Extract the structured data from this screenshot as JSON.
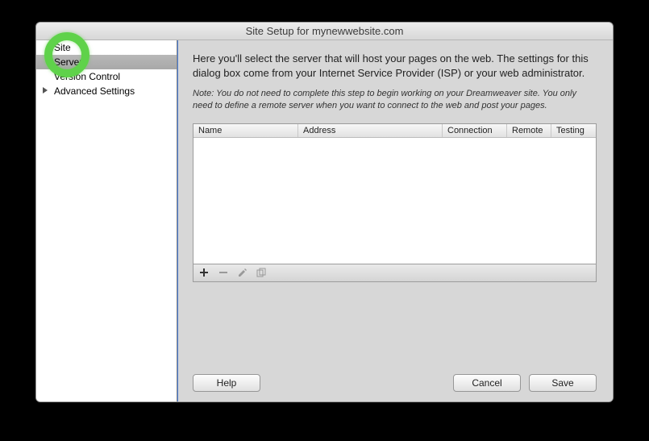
{
  "title": "Site Setup for mynewwebsite.com",
  "sidebar": {
    "items": [
      {
        "label": "Site"
      },
      {
        "label": "Servers"
      },
      {
        "label": "Version Control"
      },
      {
        "label": "Advanced Settings"
      }
    ]
  },
  "main": {
    "intro": "Here you'll select the server that will host your pages on the web. The settings for this dialog box come from your Internet Service Provider (ISP) or your web administrator.",
    "note": "Note: You do not need to complete this step to begin working on your Dreamweaver site. You only need to define a remote server when you want to connect to the web and post your pages.",
    "columns": {
      "name": "Name",
      "address": "Address",
      "connection": "Connection",
      "remote": "Remote",
      "testing": "Testing"
    }
  },
  "buttons": {
    "help": "Help",
    "cancel": "Cancel",
    "save": "Save"
  }
}
